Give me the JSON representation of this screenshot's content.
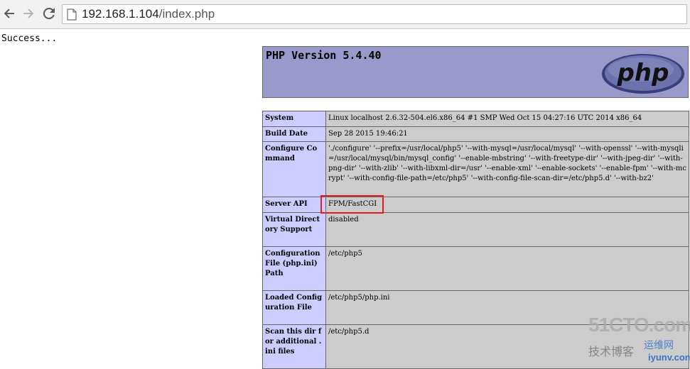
{
  "browser": {
    "url_host": "192.168.1.104",
    "url_path": "/index.php",
    "icons": [
      "back-arrow-icon",
      "forward-arrow-icon",
      "reload-icon",
      "page-icon"
    ]
  },
  "page": {
    "success_text": "Success...",
    "php_version_title": "PHP Version 5.4.40",
    "logo_text": "php",
    "info_rows": [
      {
        "label": "System",
        "value": "Linux localhost 2.6.32-504.el6.x86_64 #1 SMP Wed Oct 15 04:27:16 UTC 2014 x86_64"
      },
      {
        "label": "Build Date",
        "value": "Sep 28 2015 19:46:21"
      },
      {
        "label": "Configure Command",
        "value": "'./configure' '--prefix=/usr/local/php5' '--with-mysql=/usr/local/mysql' '--with-openssl' '--with-mysqli=/usr/local/mysql/bin/mysql_config' '--enable-mbstring' '--with-freetype-dir' '--with-jpeg-dir' '--with-png-dir' '--with-zlib' '--with-libxml-dir=/usr' '--enable-xml' '--enable-sockets' '--enable-fpm' '--with-mcrypt' '--with-config-file-path=/etc/php5' '--with-config-file-scan-dir=/etc/php5.d' '--with-bz2'"
      },
      {
        "label": "Server API",
        "value": "FPM/FastCGI"
      },
      {
        "label": "Virtual Directory Support",
        "value": "disabled"
      },
      {
        "label": "Configuration File (php.ini) Path",
        "value": "/etc/php5"
      },
      {
        "label": "Loaded Configuration File",
        "value": "/etc/php5/php.ini"
      },
      {
        "label": "Scan this dir for additional .ini files",
        "value": "/etc/php5.d"
      }
    ],
    "colors": {
      "header_bg": "#9999cc",
      "label_bg": "#ccccff",
      "value_bg": "#cccccc",
      "highlight": "#e02020"
    }
  },
  "watermark": {
    "line1": "51CTO.com",
    "line2": "技术博客",
    "line3": "运维网",
    "line4": "iyunv.com"
  }
}
